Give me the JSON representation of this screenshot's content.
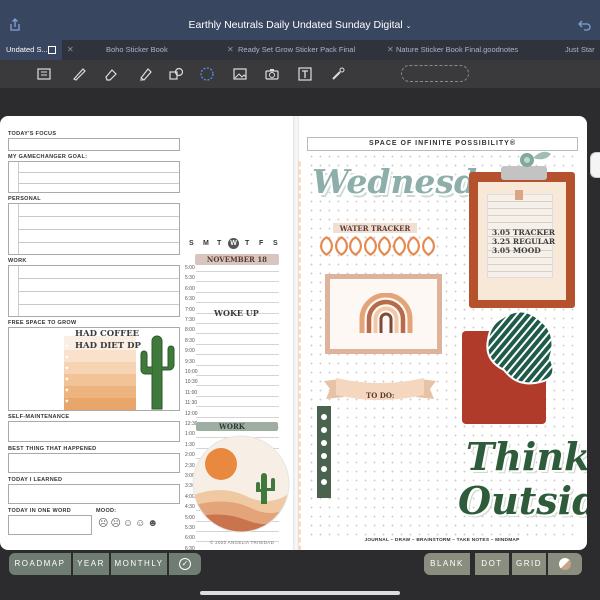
{
  "window": {
    "title": "Earthly Neutrals Daily Undated Sunday Digital"
  },
  "tabs": [
    {
      "label": "Undated S..."
    },
    {
      "label": "Boho Sticker Book"
    },
    {
      "label": "Ready Set Grow Sticker Pack Final"
    },
    {
      "label": "Nature Sticker Book Final.goodnotes"
    },
    {
      "label": "Just Star"
    }
  ],
  "toolbar": {
    "tools": [
      "reader-icon",
      "pen-icon",
      "eraser-icon",
      "highlighter-icon",
      "shapes-icon",
      "lasso-icon",
      "image-icon",
      "camera-icon",
      "text-icon",
      "laser-icon"
    ]
  },
  "left_page": {
    "sections": [
      "TODAY'S FOCUS",
      "MY GAMECHANGER GOAL:",
      "PERSONAL",
      "WORK",
      "FREE SPACE TO GROW",
      "SELF-MAINTENANCE",
      "BEST THING THAT HAPPENED",
      "TODAY I LEARNED",
      "TODAY IN ONE WORD",
      "MOOD:"
    ],
    "handwriting": [
      "HAD COFFEE",
      "HAD DIET DP"
    ],
    "weekdays": [
      "S",
      "M",
      "T",
      "W",
      "T",
      "F",
      "S"
    ],
    "selected_weekday_index": 3,
    "date": "NOVEMBER 18",
    "times": [
      "5:00",
      "5:30",
      "6:00",
      "6:30",
      "7:00",
      "7:30",
      "8:00",
      "8:30",
      "9:00",
      "9:30",
      "10:00",
      "10:30",
      "11:00",
      "11:30",
      "12:00",
      "12:30",
      "1:00",
      "1:30",
      "2:00",
      "2:30",
      "3:00",
      "3:30",
      "4:00",
      "4:30",
      "5:00",
      "5:30",
      "6:00",
      "6:30",
      "7:00",
      "7:30",
      "8:00"
    ],
    "schedule_notes": [
      "WOKE UP",
      "WORK"
    ],
    "copyright": "© 2020 ANGELIA TRINIDAD"
  },
  "right_page": {
    "header": "SPACE OF INFINITE POSSIBILITY®",
    "day_sticker": "Wednesday",
    "water_tracker_label": "WATER TRACKER",
    "water_drops": 8,
    "clipboard_lines": [
      "3.05 TRACKER",
      "3.25 REGULAR",
      "3.05 MOOD"
    ],
    "todo_label": "TO DO:",
    "think_outside": [
      "Think",
      "Outside"
    ],
    "footer": "JOURNAL – DRAW – BRAINSTORM – TAKE NOTES – MINDMAP"
  },
  "bottom_nav": {
    "left": [
      "ROADMAP",
      "YEAR",
      "MONTHLY"
    ],
    "right": [
      "BLANK",
      "DOT",
      "GRID"
    ]
  },
  "colors": {
    "title_bar": "#39465f",
    "sage": "#6f7d73",
    "terracotta": "#b5512c",
    "forest": "#2e5b3a",
    "peach": "#f2c9a6"
  }
}
